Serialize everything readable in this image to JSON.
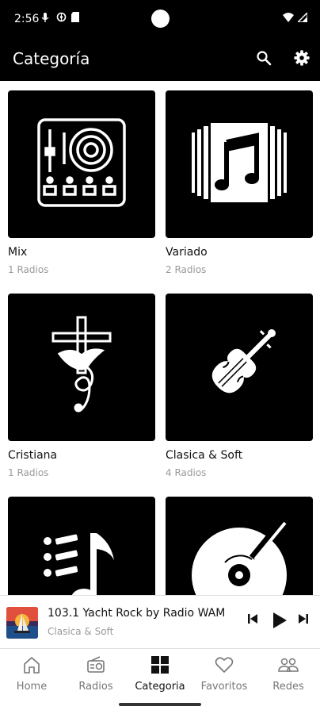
{
  "status": {
    "time": "2:56"
  },
  "appbar": {
    "title": "Categoría",
    "search_icon": "search-icon",
    "settings_icon": "gear-icon"
  },
  "categories": [
    {
      "title": "Mix",
      "count": "1 Radios",
      "icon": "turntable-icon"
    },
    {
      "title": "Variado",
      "count": "2 Radios",
      "icon": "music-note-icon"
    },
    {
      "title": "Cristiana",
      "count": "1 Radios",
      "icon": "cross-dove-icon"
    },
    {
      "title": "Clasica & Soft",
      "count": "4 Radios",
      "icon": "violin-icon"
    },
    {
      "title": "",
      "count": "",
      "icon": "music-notes-icon"
    },
    {
      "title": "",
      "count": "",
      "icon": "vinyl-icon"
    }
  ],
  "player": {
    "title": "103.1 Yacht Rock by Radio WAM",
    "subtitle": "Clasica & Soft"
  },
  "nav": {
    "items": [
      {
        "label": "Home",
        "icon": "home-icon"
      },
      {
        "label": "Radios",
        "icon": "radio-icon"
      },
      {
        "label": "Categoria",
        "icon": "grid-icon"
      },
      {
        "label": "Favoritos",
        "icon": "heart-icon"
      },
      {
        "label": "Redes",
        "icon": "people-icon"
      }
    ],
    "active": "Categoria"
  },
  "colors": {
    "bar": "#000000",
    "card": "#000000",
    "muted_text": "#9a9a9a"
  }
}
